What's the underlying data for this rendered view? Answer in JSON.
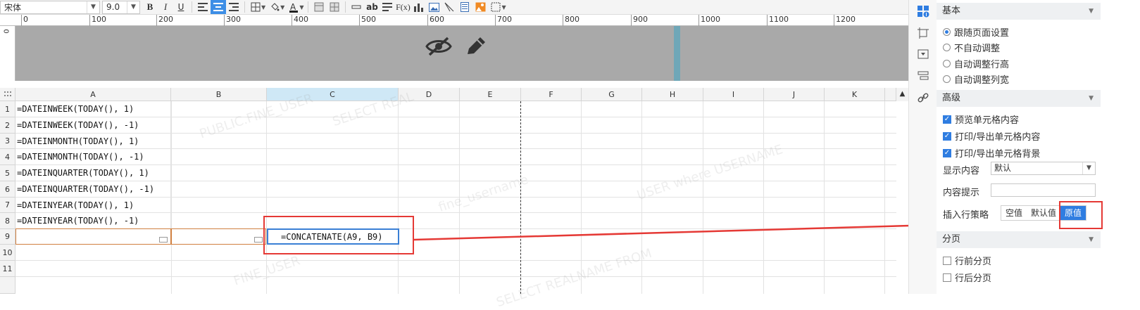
{
  "toolbar": {
    "font_family": "宋体",
    "font_size": "9.0",
    "bold": "B",
    "italic": "I",
    "underline": "U",
    "text_ab": "ab",
    "fx": "F(x)"
  },
  "ruler": {
    "ticks": [
      "0",
      "100",
      "200",
      "300",
      "400",
      "500",
      "600",
      "700",
      "800",
      "900",
      "1000",
      "1100",
      "1200"
    ],
    "vertical": "0"
  },
  "columns": [
    "A",
    "B",
    "C",
    "D",
    "E",
    "F",
    "G",
    "H",
    "I",
    "J",
    "K"
  ],
  "active_column": "C",
  "rows": [
    "1",
    "2",
    "3",
    "4",
    "5",
    "6",
    "7",
    "8",
    "9",
    "10",
    "11"
  ],
  "cells_a": [
    "=DATEINWEEK(TODAY(), 1)",
    "=DATEINWEEK(TODAY(), -1)",
    "=DATEINMONTH(TODAY(), 1)",
    "=DATEINMONTH(TODAY(), -1)",
    "=DATEINQUARTER(TODAY(), 1)",
    "=DATEINQUARTER(TODAY(), -1)",
    "=DATEINYEAR(TODAY(), 1)",
    "=DATEINYEAR(TODAY(), -1)"
  ],
  "cell_c9": "=CONCATENATE(A9, B9)",
  "panel": {
    "basic": {
      "title": "基本",
      "options": [
        "跟随页面设置",
        "不自动调整",
        "自动调整行高",
        "自动调整列宽"
      ],
      "selected_index": 0
    },
    "advanced": {
      "title": "高级",
      "checkboxes": [
        "预览单元格内容",
        "打印/导出单元格内容",
        "打印/导出单元格背景"
      ],
      "display_label": "显示内容",
      "display_value": "默认",
      "tip_label": "内容提示",
      "tip_value": "",
      "insert_label": "插入行策略",
      "insert_options": [
        "空值",
        "默认值",
        "原值"
      ],
      "insert_selected": "原值"
    },
    "paging": {
      "title": "分页",
      "options": [
        "行前分页",
        "行后分页"
      ]
    }
  },
  "colors": {
    "accent": "#2f7de1",
    "highlight_box": "#e53935",
    "header_band": "#a9a9a9"
  }
}
